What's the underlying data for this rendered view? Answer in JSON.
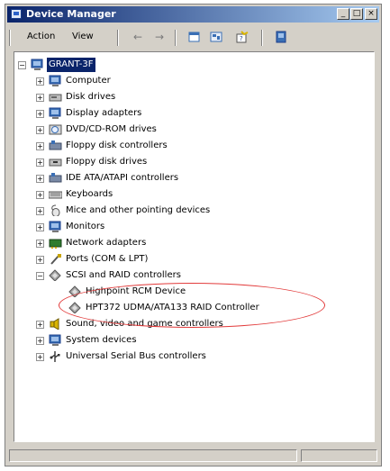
{
  "window": {
    "title": "Device Manager",
    "controls": [
      "_",
      "□",
      "×"
    ]
  },
  "menu": {
    "action": "Action",
    "view": "View"
  },
  "toolbar": {
    "back": "←",
    "forward": "→",
    "buttons": [
      "properties-icon",
      "refresh-icon",
      "help-icon",
      "scan-hardware-icon"
    ]
  },
  "tree": {
    "root": "GRANT-3F",
    "items": [
      "Computer",
      "Disk drives",
      "Display adapters",
      "DVD/CD-ROM drives",
      "Floppy disk controllers",
      "Floppy disk drives",
      "IDE ATA/ATAPI controllers",
      "Keyboards",
      "Mice and other pointing devices",
      "Monitors",
      "Network adapters",
      "Ports (COM & LPT)",
      "SCSI and RAID controllers",
      "Highpoint RCM Device",
      "HPT372 UDMA/ATA133 RAID Controller",
      "Sound, video and game controllers",
      "System devices",
      "Universal Serial Bus controllers"
    ]
  },
  "colors": {
    "highlight": "#e23a3a",
    "selection": "#0a246a",
    "titlebar": "#0a246a"
  }
}
